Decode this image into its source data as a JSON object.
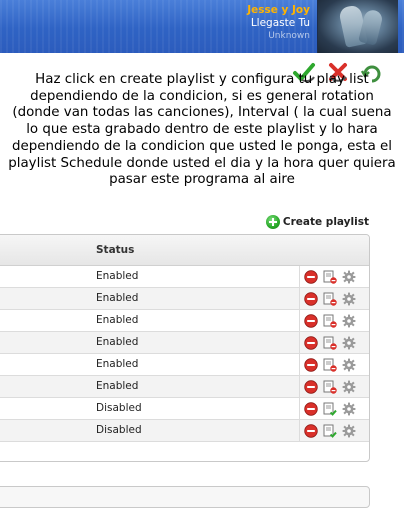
{
  "now_playing": {
    "artist": "Jesse y Joy",
    "title": "Llegaste Tu",
    "album": "Unknown"
  },
  "toolbar": {
    "icons": [
      "check-icon",
      "cancel-icon",
      "refresh-icon"
    ]
  },
  "instruction_text": "Haz click en create playlist y configura tu play list dependiendo de la condicion, si es general rotation (donde van todas las canciones), Interval ( la cual suena lo que esta grabado dentro de este playlist y lo hara dependiendo de la condicion que usted le ponga, esta el playlist Schedule donde usted el dia y la hora quer quiera pasar este programa al aire",
  "create_playlist": {
    "label": "Create playlist",
    "icon": "plus-circle-icon"
  },
  "table": {
    "columns": [
      "Status"
    ],
    "rows": [
      {
        "status": "Enabled",
        "toggle": "disable"
      },
      {
        "status": "Enabled",
        "toggle": "disable"
      },
      {
        "status": "Enabled",
        "toggle": "disable"
      },
      {
        "status": "Enabled",
        "toggle": "disable"
      },
      {
        "status": "Enabled",
        "toggle": "disable"
      },
      {
        "status": "Enabled",
        "toggle": "disable"
      },
      {
        "status": "Disabled",
        "toggle": "enable"
      },
      {
        "status": "Disabled",
        "toggle": "enable"
      }
    ],
    "actions": [
      "delete-icon",
      "toggle-playlist-icon",
      "settings-gear-icon"
    ]
  },
  "colors": {
    "header_blue": "#2f63c4",
    "artist_orange": "#ffb400",
    "delete_red": "#d9302a",
    "enable_green": "#2ea82e"
  }
}
